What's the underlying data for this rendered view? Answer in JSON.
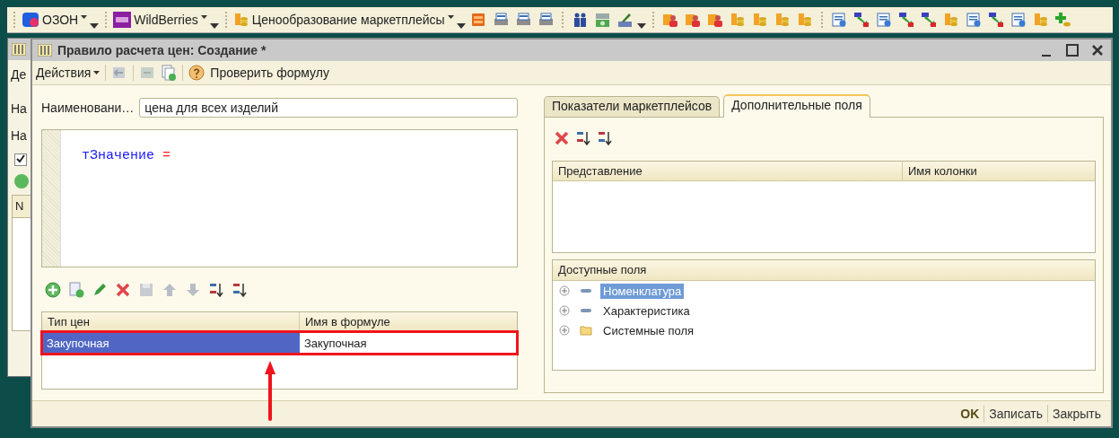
{
  "toolbar": {
    "menus": [
      {
        "label": "ОЗОН",
        "kind": "ozon"
      },
      {
        "label": "WildBerries",
        "kind": "wb"
      },
      {
        "label": "Ценообразование маркетплейсы",
        "kind": "coins"
      }
    ]
  },
  "background_window": {
    "texts": [
      "Де",
      "На",
      "На"
    ],
    "checkbox": {
      "checked": true
    },
    "column_1": "N"
  },
  "dialog": {
    "title": "Правило расчета цен: Создание *",
    "toolbar": {
      "actions": "Действия",
      "check_formula": "Проверить формулу"
    },
    "name_label": "Наименовани…",
    "name_value": "цена для всех изделий",
    "formula": [
      {
        "text": "тЗначение",
        "kind": "identifier"
      },
      {
        "text": "=",
        "kind": "operator"
      }
    ],
    "price_table": {
      "columns": [
        "Тип цен",
        "Имя в формуле"
      ],
      "rows": [
        {
          "selected": true,
          "cells": [
            {
              "text": "Закупочная",
              "highlighted": true
            },
            {
              "text": "Закупочная",
              "highlighted": false
            }
          ]
        }
      ]
    },
    "tabs": [
      {
        "label": "Показатели маркетплейсов",
        "selected": false
      },
      {
        "label": "Дополнительные поля",
        "selected": true
      }
    ],
    "fields_table": {
      "columns": [
        "Представление",
        "Имя колонки"
      ]
    },
    "available_fields": {
      "header": "Доступные поля",
      "items": [
        {
          "label": "Номенклатура",
          "kind": "field",
          "selected": true
        },
        {
          "label": "Характеристика",
          "kind": "field",
          "selected": false
        },
        {
          "label": "Системные поля",
          "kind": "folder",
          "selected": false
        }
      ]
    },
    "buttons": [
      {
        "label": "OK",
        "default": true
      },
      {
        "label": "Записать",
        "default": false
      },
      {
        "label": "Закрыть",
        "default": false
      }
    ]
  }
}
